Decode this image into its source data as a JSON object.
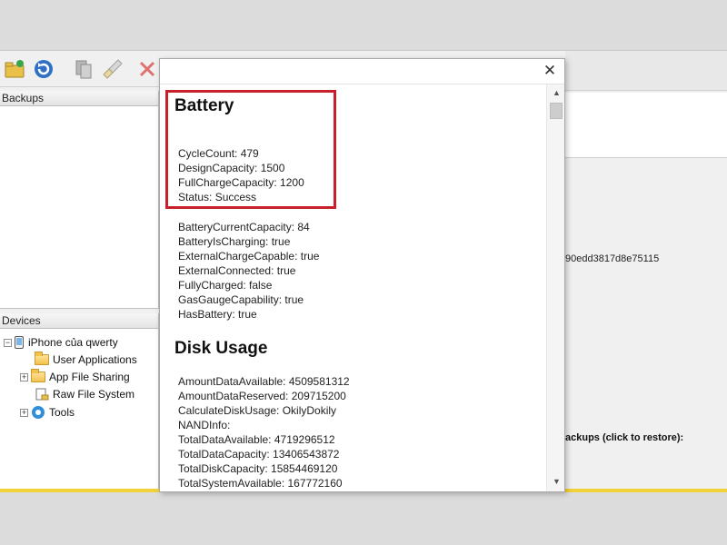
{
  "panes": {
    "backups_header": "Backups",
    "devices_header": "Devices"
  },
  "device_tree": {
    "device_name": "iPhone của qwerty",
    "items": [
      {
        "label": "User Applications"
      },
      {
        "label": "App File Sharing"
      },
      {
        "label": "Raw File System"
      },
      {
        "label": "Tools"
      }
    ]
  },
  "right_pane": {
    "hash_fragment": "90edd3817d8e75115",
    "backups_label": "ackups (click to restore):"
  },
  "dialog": {
    "close_glyph": "✕",
    "battery": {
      "title": "Battery",
      "highlighted_lines": [
        "CycleCount: 479",
        "DesignCapacity: 1500",
        "FullChargeCapacity: 1200",
        "Status: Success"
      ],
      "lines": [
        "BatteryCurrentCapacity: 84",
        "BatteryIsCharging: true",
        "ExternalChargeCapable: true",
        "ExternalConnected: true",
        "FullyCharged: false",
        "GasGaugeCapability: true",
        "HasBattery: true"
      ]
    },
    "disk_usage": {
      "title": "Disk Usage",
      "lines": [
        "AmountDataAvailable: 4509581312",
        "AmountDataReserved: 209715200",
        "CalculateDiskUsage: OkilyDokily",
        "NANDInfo:",
        "TotalDataAvailable: 4719296512",
        "TotalDataCapacity: 13406543872",
        "TotalDiskCapacity: 15854469120",
        "TotalSystemAvailable: 167772160"
      ]
    }
  },
  "colors": {
    "highlight_border": "#c8202b",
    "accent_bar": "#f2d23a"
  }
}
